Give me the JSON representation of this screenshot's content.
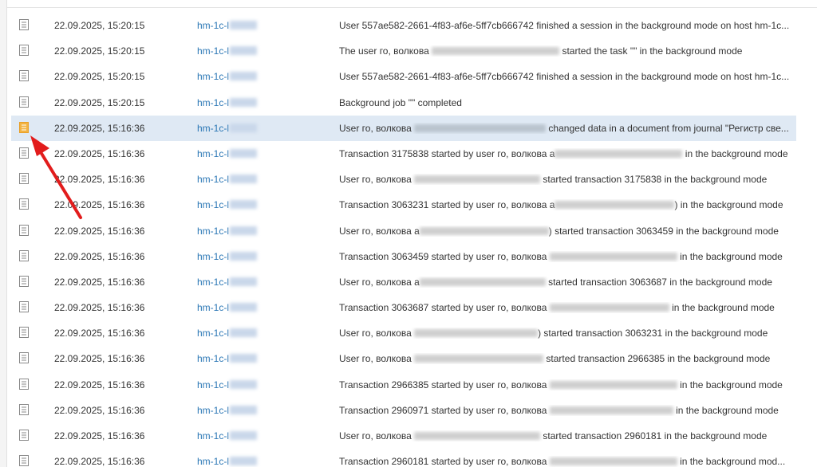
{
  "colors": {
    "link": "#2b77b5",
    "selection": "#dfe9f4",
    "arrow": "#e21c1c",
    "icon_normal": "#888888",
    "icon_changed": "#e8a02a"
  },
  "rows": [
    {
      "icon": "document-icon",
      "date": "22.09.2025, 15:20:15",
      "host": "hm-1c-l",
      "parts": [
        "User 557ae582-2661-4f83-af6e-5ff7cb666742 finished a session in the background mode on host hm-1c..."
      ]
    },
    {
      "icon": "document-icon",
      "date": "22.09.2025, 15:20:15",
      "host": "hm-1c-l",
      "parts": [
        "The user го, волкова ",
        "",
        " started the task \"\" in the background mode"
      ]
    },
    {
      "icon": "document-icon",
      "date": "22.09.2025, 15:20:15",
      "host": "hm-1c-l",
      "parts": [
        "User 557ae582-2661-4f83-af6e-5ff7cb666742 finished a session in the background mode on host hm-1c..."
      ]
    },
    {
      "icon": "document-icon",
      "date": "22.09.2025, 15:20:15",
      "host": "hm-1c-l",
      "parts": [
        "Background job \"\" completed"
      ]
    },
    {
      "icon": "document-changed-icon",
      "date": "22.09.2025, 15:16:36",
      "host": "hm-1c-l",
      "parts": [
        "User го, волкова ",
        "",
        " changed data in a document from journal \"Регистр све..."
      ]
    },
    {
      "icon": "document-icon",
      "date": "22.09.2025, 15:16:36",
      "host": "hm-1c-l",
      "parts": [
        "Transaction 3175838 started by user го, волкова а",
        "",
        " in the background mode"
      ]
    },
    {
      "icon": "document-icon",
      "date": "22.09.2025, 15:16:36",
      "host": "hm-1c-l",
      "parts": [
        "User го, волкова ",
        "",
        " started transaction 3175838 in the background mode"
      ]
    },
    {
      "icon": "document-icon",
      "date": "22.09.2025, 15:16:36",
      "host": "hm-1c-l",
      "parts": [
        "Transaction 3063231 started by user го, волкова а",
        "",
        ") in the background mode"
      ]
    },
    {
      "icon": "document-icon",
      "date": "22.09.2025, 15:16:36",
      "host": "hm-1c-l",
      "parts": [
        "User го, волкова а",
        "",
        ") started transaction 3063459 in the background mode"
      ]
    },
    {
      "icon": "document-icon",
      "date": "22.09.2025, 15:16:36",
      "host": "hm-1c-l",
      "parts": [
        "Transaction 3063459 started by user го, волкова ",
        "",
        " in the background mode"
      ]
    },
    {
      "icon": "document-icon",
      "date": "22.09.2025, 15:16:36",
      "host": "hm-1c-l",
      "parts": [
        "User го, волкова а",
        "",
        " started transaction 3063687 in the background mode"
      ]
    },
    {
      "icon": "document-icon",
      "date": "22.09.2025, 15:16:36",
      "host": "hm-1c-l",
      "parts": [
        "Transaction 3063687 started by user го, волкова ",
        "",
        " in the background mode"
      ]
    },
    {
      "icon": "document-icon",
      "date": "22.09.2025, 15:16:36",
      "host": "hm-1c-l",
      "parts": [
        "User го, волкова ",
        "",
        ") started transaction 3063231 in the background mode"
      ]
    },
    {
      "icon": "document-icon",
      "date": "22.09.2025, 15:16:36",
      "host": "hm-1c-l",
      "parts": [
        "User го, волкова ",
        "",
        " started transaction 2966385 in the background mode"
      ]
    },
    {
      "icon": "document-icon",
      "date": "22.09.2025, 15:16:36",
      "host": "hm-1c-l",
      "parts": [
        "Transaction 2966385 started by user го, волкова ",
        "",
        " in the background mode"
      ]
    },
    {
      "icon": "document-icon",
      "date": "22.09.2025, 15:16:36",
      "host": "hm-1c-l",
      "parts": [
        "Transaction 2960971 started by user го, волкова ",
        "",
        " in the background mode"
      ]
    },
    {
      "icon": "document-icon",
      "date": "22.09.2025, 15:16:36",
      "host": "hm-1c-l",
      "parts": [
        "User го, волкова ",
        "",
        " started transaction 2960181 in the background mode"
      ]
    },
    {
      "icon": "document-icon",
      "date": "22.09.2025, 15:16:36",
      "host": "hm-1c-l",
      "parts": [
        "Transaction 2960181 started by user го, волкова ",
        "",
        " in the background mod..."
      ]
    }
  ],
  "selected_row": 4,
  "annotation": {
    "icon": "arrow-icon"
  }
}
